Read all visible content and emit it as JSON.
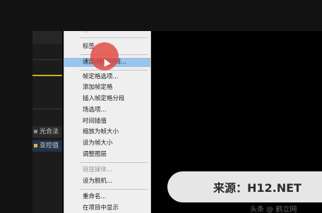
{
  "app": {
    "panel_rows": [
      {
        "label": "光合法",
        "swatch_color": "#8a8a8a"
      },
      {
        "label": "亚控值",
        "swatch_color": "#e0b43c"
      }
    ],
    "accent_color": "#cfb014"
  },
  "context_menu": {
    "items": [
      {
        "label": "…",
        "state": "disabled"
      },
      {
        "label": "标签",
        "state": "normal"
      },
      {
        "label": "速度/持续时间...",
        "state": "highlighted"
      },
      {
        "label": "帧定格选项...",
        "state": "normal"
      },
      {
        "label": "添加帧定格",
        "state": "normal"
      },
      {
        "label": "插入帧定格分段",
        "state": "normal"
      },
      {
        "label": "场选项...",
        "state": "normal"
      },
      {
        "label": "时间插值",
        "state": "normal"
      },
      {
        "label": "缩放为帧大小",
        "state": "normal"
      },
      {
        "label": "设为帧大小",
        "state": "normal"
      },
      {
        "label": "调整图层",
        "state": "normal"
      },
      {
        "label": "链接媒体...",
        "state": "disabled"
      },
      {
        "label": "设为脱机...",
        "state": "normal"
      },
      {
        "label": "重命名...",
        "state": "normal"
      },
      {
        "label": "在项目中显示",
        "state": "normal"
      }
    ],
    "highlight_color": "#99c4ec"
  },
  "watermark": {
    "label": "来源：H12.NET",
    "faint": "头条 @ 鹤立网"
  }
}
